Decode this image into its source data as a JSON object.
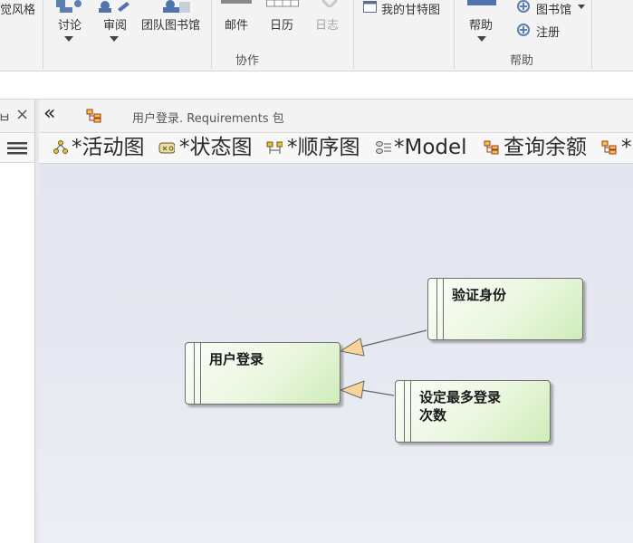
{
  "ribbon": {
    "style_label": "觉风格",
    "discuss_label": "讨论",
    "review_label": "审阅",
    "team_library_label": "团队图书馆",
    "mail_label": "邮件",
    "calendar_label": "日历",
    "log_label": "日志",
    "gantt_label": "我的甘特图",
    "help_label": "帮助",
    "library_label": "图书馆",
    "register_label": "注册",
    "group_collaborate": "协作",
    "group_help": "帮助"
  },
  "left_panel": {
    "pin_glyph": "ㅂ",
    "close_glyph": "×",
    "menu_glyph": "≡"
  },
  "diagram": {
    "collapse_glyph": "«",
    "breadcrumb": "用户登录.  Requirements 包",
    "tabs": [
      {
        "label": "*活动图",
        "icon": "activity-diagram-icon"
      },
      {
        "label": "*状态图",
        "icon": "state-diagram-icon"
      },
      {
        "label": "*顺序图",
        "icon": "sequence-diagram-icon"
      },
      {
        "label": "*Model",
        "icon": "model-icon"
      },
      {
        "label": "查询余额",
        "icon": "package-diagram-icon"
      },
      {
        "label": "*",
        "icon": "package-diagram-icon"
      }
    ],
    "nodes": [
      {
        "id": "verify",
        "label": "验证身份"
      },
      {
        "id": "login",
        "label": "用户登录"
      },
      {
        "id": "maxlogin",
        "label_line1": "设定最多登录",
        "label_line2": "次数"
      }
    ]
  },
  "colors": {
    "ribbon_bg": "#f3f3f3",
    "canvas_bg": "#e5e7f0",
    "node_fill_light": "#fbfdf8",
    "node_fill_dark": "#cfecb9",
    "arrow_head_fill": "#f8d39a"
  }
}
